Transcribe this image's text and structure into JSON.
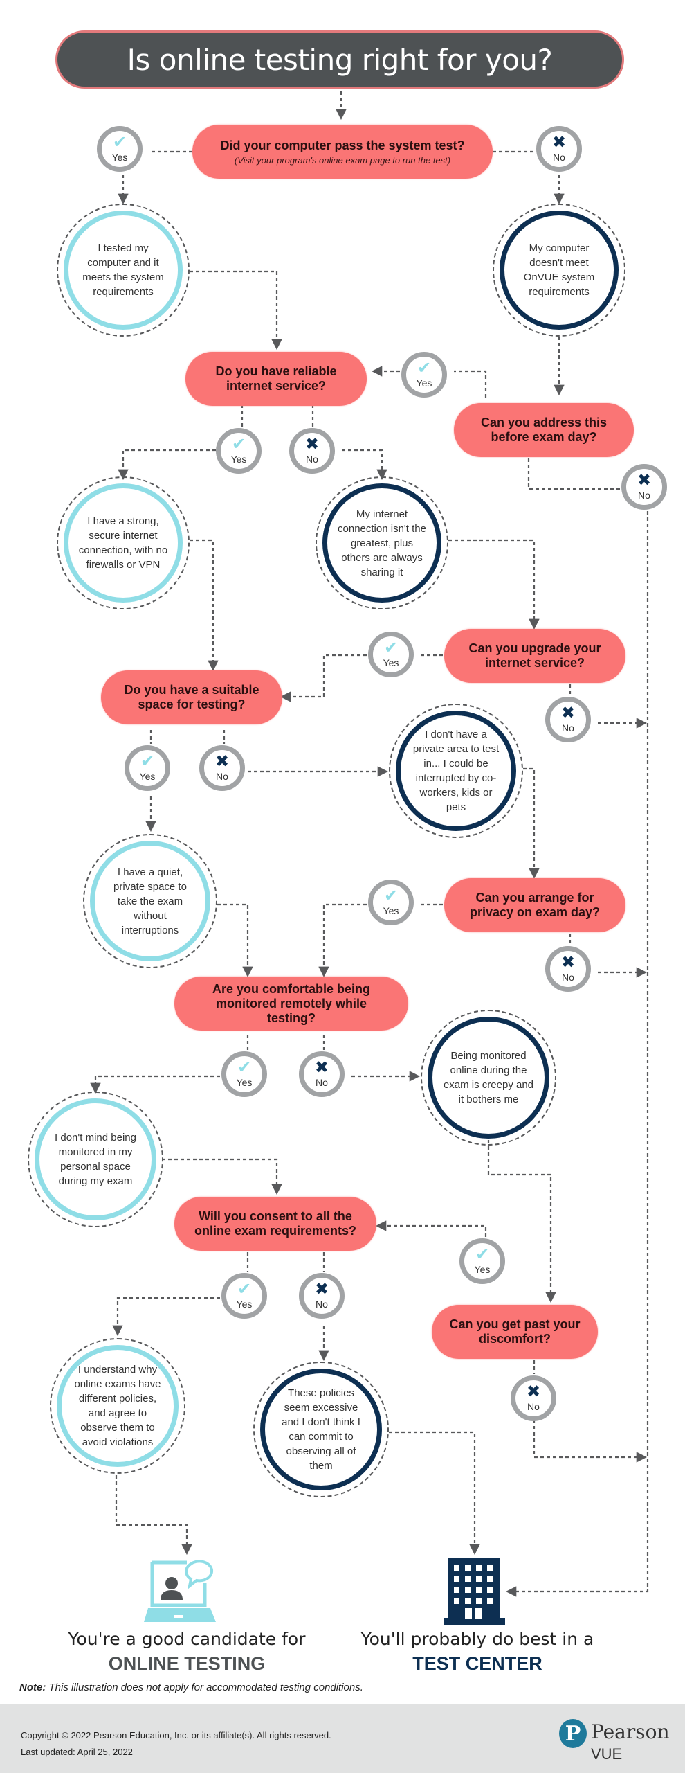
{
  "title": "Is online testing right for you?",
  "colors": {
    "question": "#fa7575",
    "title_bg": "#4e5254",
    "positive": "#8fdde6",
    "negative": "#0d2f52",
    "answer_ring": "#a1a3a5",
    "connector": "#58595b",
    "footer_bg": "#e1e2e2",
    "brand": "#1f7a9b"
  },
  "answer_labels": {
    "yes": "Yes",
    "no": "No",
    "yes_icon": "✔",
    "no_icon": "✖"
  },
  "questions": {
    "q1": {
      "text": "Did your computer pass the system test?",
      "sub": "(Visit your program's online exam page to run the test)"
    },
    "q2": {
      "text": "Do you have reliable internet service?"
    },
    "q3": {
      "text": "Can you address this before exam day?"
    },
    "q4": {
      "text": "Can you upgrade your internet service?"
    },
    "q5": {
      "text": "Do you have a suitable space for testing?"
    },
    "q6": {
      "text": "Can you arrange for privacy on exam day?"
    },
    "q7": {
      "text": "Are you comfortable being monitored remotely while testing?"
    },
    "q8": {
      "text": "Will you consent to all the online exam requirements?"
    },
    "q9": {
      "text": "Can you get past your discomfort?"
    }
  },
  "statements": {
    "s1": "I tested my computer and it meets the system requirements",
    "s2": "My computer doesn't meet OnVUE system requirements",
    "s3": "I have a strong, secure internet connection, with no firewalls or VPN",
    "s4": "My internet connection isn't the greatest, plus others are always sharing it",
    "s5": "I don't have a private area to test in... I could be interrupted by co-workers, kids or pets",
    "s6": "I have a quiet, private space to take the exam without interruptions",
    "s7": "Being monitored online during the exam is creepy and it bothers me",
    "s8": "I don't mind being monitored in my personal space during my exam",
    "s9": "I understand why online exams have different policies, and agree to observe them to avoid violations",
    "s10": "These policies seem excessive and I don't think I can commit to observing all of them"
  },
  "outcomes": {
    "online": {
      "line1": "You're a good candidate for",
      "line2": "ONLINE TESTING"
    },
    "center": {
      "line1": "You'll probably do best in a",
      "line2": "TEST CENTER"
    }
  },
  "note": {
    "label": "Note:",
    "text": " This illustration does not apply for accommodated testing conditions."
  },
  "footer": {
    "copyright": "Copyright © 2022 Pearson Education, Inc. or its affiliate(s).  All rights reserved.",
    "updated": "Last updated: April 25, 2022",
    "logo_letter": "P",
    "logo_name": "Pearson",
    "logo_sub": "VUE"
  }
}
